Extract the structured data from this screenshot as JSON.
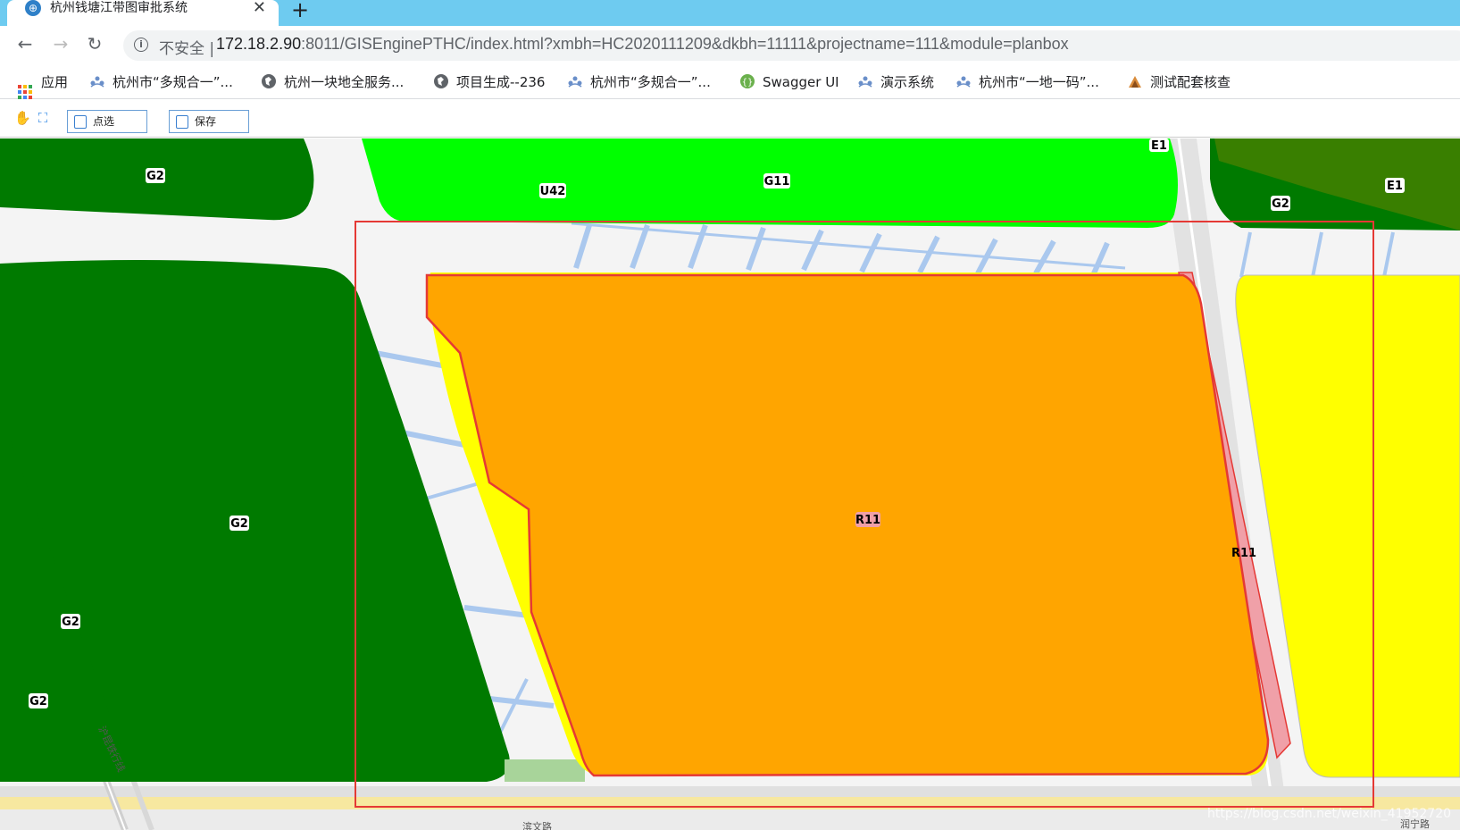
{
  "browser": {
    "tab_title": "杭州钱塘江带图审批系统",
    "tab_close": "✕",
    "new_tab": "+",
    "insecure_label": "不安全",
    "separator": "|",
    "url_host": "172.18.2.90",
    "url_rest": ":8011/GISEnginePTHC/index.html?xmbh=HC2020111209&dkbh=11111&projectname=111&module=planbox"
  },
  "bookmarks": [
    {
      "label": "应用",
      "icon": "apps-grid-icon"
    },
    {
      "label": "杭州市“多规合一”...",
      "icon": "network-icon"
    },
    {
      "label": "杭州一块地全服务...",
      "icon": "globe-icon"
    },
    {
      "label": "项目生成--236",
      "icon": "globe-icon"
    },
    {
      "label": "杭州市“多规合一”...",
      "icon": "network-icon"
    },
    {
      "label": "Swagger UI",
      "icon": "swagger-icon"
    },
    {
      "label": "演示系统",
      "icon": "network-icon"
    },
    {
      "label": "杭州市“一地一码”...",
      "icon": "network-icon"
    },
    {
      "label": "测试配套核查",
      "icon": "tool-icon"
    }
  ],
  "toolbar": {
    "select_label": "点选",
    "save_label": "保存"
  },
  "map": {
    "labels": {
      "g2_top_left": "G2",
      "u42": "U42",
      "g11": "G11",
      "e1_top": "E1",
      "g2_top_right": "G2",
      "e1_right": "E1",
      "g2_center": "G2",
      "r11_main": "R11",
      "r11_side": "R11",
      "g2_small1": "G2",
      "g2_small2": "G2",
      "rail_label": "沪昆铁行线",
      "road_bottom_left": "滨文路",
      "road_bottom_right": "润宁路"
    },
    "colors": {
      "green_dark": "#007a00",
      "green_bright": "#00ff00",
      "green_olive": "#3f7f00",
      "orange": "#ffa500",
      "yellow": "#ffff00",
      "pink": "#f0a0a8",
      "red_outline": "#e53935",
      "road": "#ffffff",
      "water": "#aac8ee"
    },
    "watermark": "https://blog.csdn.net/weixin_41952720"
  }
}
